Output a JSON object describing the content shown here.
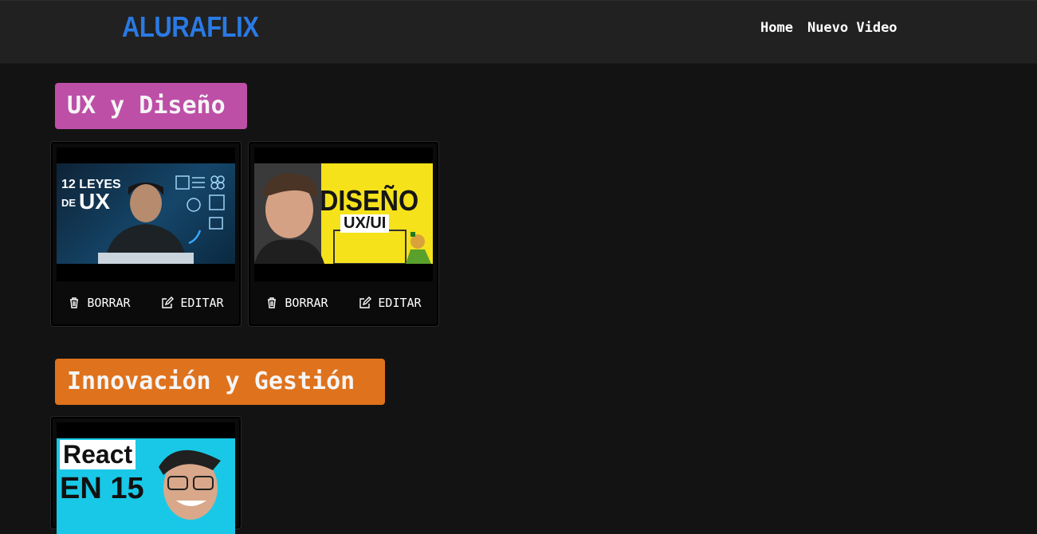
{
  "header": {
    "logo": "ALURAFLIX",
    "nav": [
      "Home",
      "Nuevo Video"
    ]
  },
  "colors": {
    "brand": "#2a7ae4",
    "ux_category": "#bd4fa7",
    "innovation_category": "#df721c"
  },
  "categories": [
    {
      "title": "UX y Diseño",
      "videos": [
        {
          "thumb_text_1": "12 LEYES",
          "thumb_text_2": "DE",
          "thumb_text_3": "UX",
          "delete_label": "BORRAR",
          "edit_label": "EDITAR"
        },
        {
          "thumb_text_1": "DISEÑO",
          "thumb_text_2": "UX/UI",
          "delete_label": "BORRAR",
          "edit_label": "EDITAR"
        }
      ]
    },
    {
      "title": "Innovación y Gestión",
      "videos": [
        {
          "thumb_text_1": "React",
          "thumb_text_2": "EN 15"
        }
      ]
    }
  ]
}
